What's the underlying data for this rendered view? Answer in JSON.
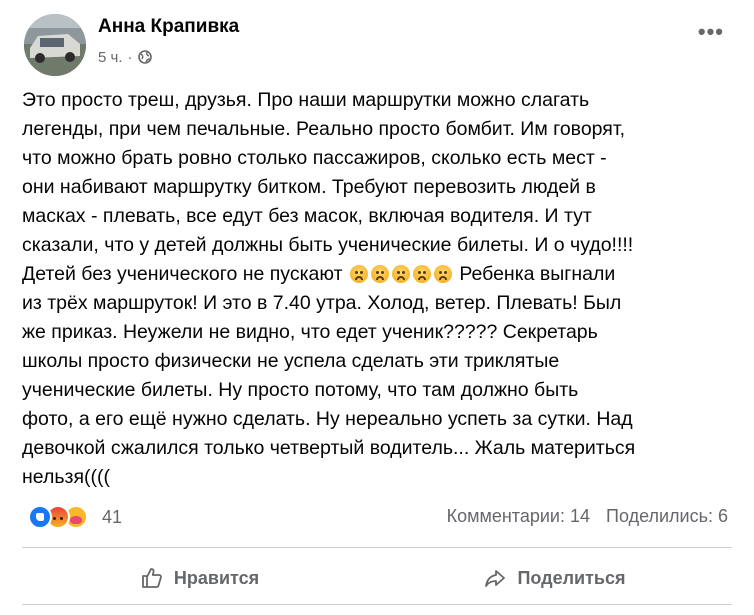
{
  "post": {
    "author": "Анна Крапивка",
    "time": "5 ч.",
    "separator": "·",
    "audience_icon": "globe-icon",
    "more_icon": "•••",
    "text_part1": "Это просто треш, друзья. Про наши маршрутки можно слагать\nлегенды, при чем печальные. Реально просто бомбит. Им говорят,\nчто можно брать ровно столько пассажиров, сколько есть мест -\nони набивают маршрутку битком. Требуют перевозить людей в\nмасках - плевать, все едут без масок, включая водителя. И тут\nсказали, что у детей должны быть ученические билеты. И о чудо!!!!\nДетей без ученического не пускают ",
    "emoji_name": "frowning-face-emoji",
    "emoji_count": 5,
    "text_part2": " Ребенка выгнали\nиз трёх маршруток! И это в 7.40 утра. Холод, ветер. Плевать! Был\nже приказ. Неужели не видно, что едет ученик????? Секретарь\nшколы просто физически не успела сделать эти триклятые\nученические билеты. Ну просто потому, что там должно быть\nфото, а его ещё нужно сделать. Ну нереально успеть за сутки. Над\nдевочкой сжалился только четвертый водитель... Жаль материться\nнельзя(((("
  },
  "reactions": {
    "types": [
      "like",
      "angry",
      "care"
    ],
    "count": "41"
  },
  "stats": {
    "comments": "Комментарии: 14",
    "shares": "Поделились: 6"
  },
  "actions": {
    "like_label": "Нравится",
    "share_label": "Поделиться"
  },
  "colors": {
    "text": "#050505",
    "secondary": "#65676b",
    "like_blue": "#1877f2",
    "divider": "#ced0d4"
  }
}
